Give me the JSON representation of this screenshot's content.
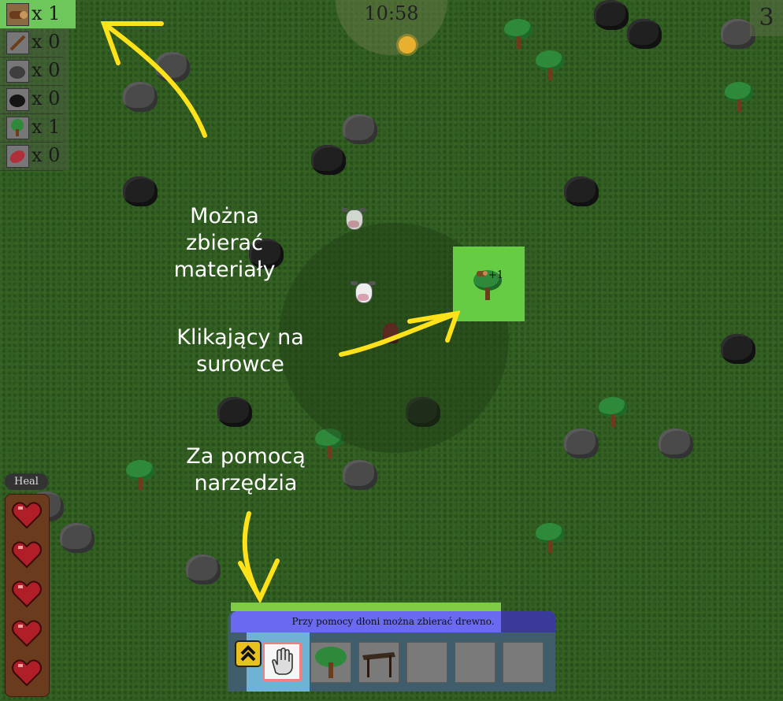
{
  "clock": {
    "time": "10:58"
  },
  "day": {
    "number": "3"
  },
  "resources": [
    {
      "icon": "wood-log-icon",
      "count": "x 1",
      "active": true
    },
    {
      "icon": "stick-icon",
      "count": "x 0"
    },
    {
      "icon": "stone-icon",
      "count": "x 0"
    },
    {
      "icon": "coal-icon",
      "count": "x 0"
    },
    {
      "icon": "tree-sapling-icon",
      "count": "x 1"
    },
    {
      "icon": "raw-meat-icon",
      "count": "x 0"
    }
  ],
  "annotations": {
    "collect": [
      "Można zbierać",
      "materiały"
    ],
    "click": [
      "Klikający na",
      "surowce"
    ],
    "tool": [
      "Za pomocą",
      "narzędzia"
    ]
  },
  "gain_popup": "+1",
  "health": {
    "heal_label": "Heal",
    "hearts": 5
  },
  "hotbar": {
    "tooltip": "Przy pomocy dłoni można zbierać drewno.",
    "slots": [
      {
        "icon": "hand-icon",
        "selected": true
      },
      {
        "icon": "tree-icon"
      },
      {
        "icon": "shelter-icon"
      },
      {
        "icon": ""
      },
      {
        "icon": ""
      },
      {
        "icon": ""
      }
    ]
  },
  "colors": {
    "annotation_arrow": "#ffe21a",
    "selection": "#66cc44",
    "tooltip_bg": "#6a6af0"
  }
}
